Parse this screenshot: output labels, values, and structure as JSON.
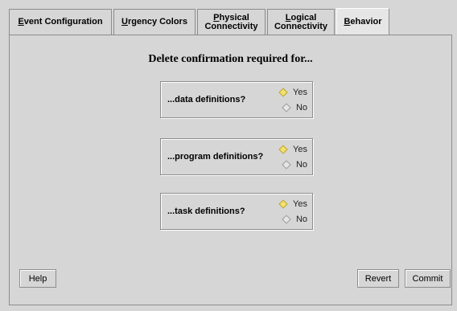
{
  "tabs": [
    {
      "pre": "",
      "ul": "E",
      "post": "vent Configuration"
    },
    {
      "pre": "",
      "ul": "U",
      "post": "rgency Colors"
    },
    {
      "line1_ul": "P",
      "line1_post": "hysical",
      "line2": "Connectivity"
    },
    {
      "line1_ul": "L",
      "line1_post": "ogical",
      "line2": "Connectivity"
    },
    {
      "pre": "",
      "ul": "B",
      "post": "ehavior"
    }
  ],
  "active_tab_index": 4,
  "heading": "Delete confirmation required for...",
  "groups": [
    {
      "label": "...data definitions?",
      "yes": "Yes",
      "no": "No",
      "selected": "Yes"
    },
    {
      "label": "...program definitions?",
      "yes": "Yes",
      "no": "No",
      "selected": "Yes"
    },
    {
      "label": "...task definitions?",
      "yes": "Yes",
      "no": "No",
      "selected": "Yes"
    }
  ],
  "buttons": {
    "help": "Help",
    "revert": "Revert",
    "commit": "Commit"
  },
  "colors": {
    "radio_on": "#f4e16a",
    "background": "#d6d6d6"
  }
}
